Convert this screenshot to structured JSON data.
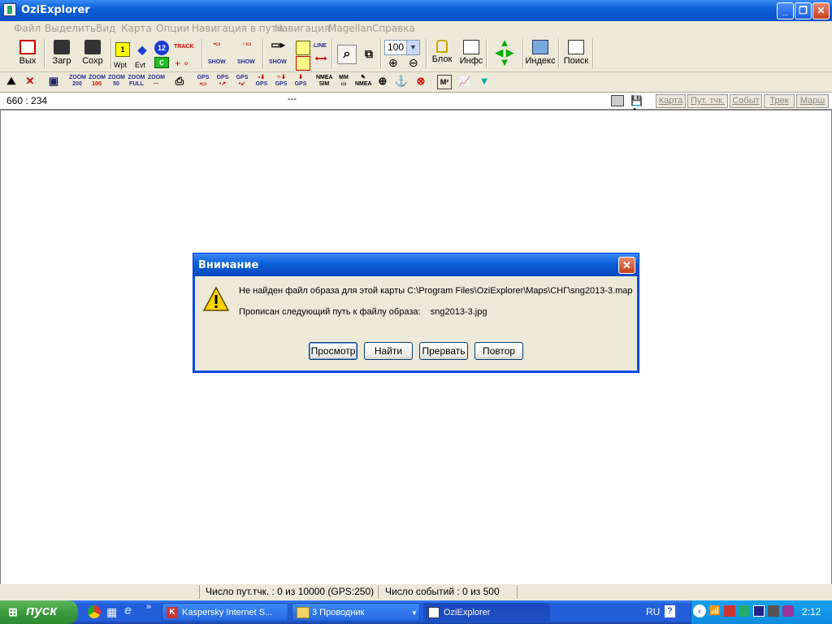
{
  "window": {
    "title": "OziExplorer"
  },
  "menu": [
    "Файл",
    "Выделить",
    "Вид",
    "Карта",
    "Опции",
    "Навигация в пути",
    "Навигация",
    "Magellan",
    "Справка"
  ],
  "toolbar": {
    "exit": "Вых",
    "load": "Загр",
    "save": "Сохр",
    "wpt": "Wpt",
    "evt": "Evt",
    "track": "TRACK",
    "show": "SHOW",
    "line": "LINE",
    "zoom_value": "100",
    "block": "Блок",
    "info": "Инфс",
    "index": "Индекс",
    "search": "Поиск"
  },
  "toolbar2": {
    "zoom200": "200",
    "zoom100": "100",
    "zoom50": "50",
    "zoomfull": "FULL",
    "zoom_word": "ZOOM",
    "gps": "GPS",
    "nmea": "NMEA",
    "sim": "SIM",
    "mm": "MM",
    "m2": "M²"
  },
  "infobar": {
    "coords": "660 : 234",
    "dash": "---",
    "tabs": [
      "Карта",
      "Пут. тчк.",
      "Событ",
      "Трек",
      "Марш"
    ]
  },
  "status": {
    "waypoints": "Число пут.тчк. : 0 из 10000  (GPS:250)",
    "events": "Число событий : 0 из 500"
  },
  "dialog": {
    "title": "Внимание",
    "line1": "Не найден файл образа для этой карты  C:\\Program Files\\OziExplorer\\Maps\\СНГ\\sng2013-3.map",
    "line2": "Прописан следующий путь к файлу образа:    sng2013-3.jpg",
    "buttons": [
      "Просмотр",
      "Найти",
      "Прервать",
      "Повтор"
    ]
  },
  "taskbar": {
    "start": "пуск",
    "tasks": [
      "Kaspersky Internet S...",
      "3 Проводник",
      "OziExplorer"
    ],
    "lang": "RU",
    "clock": "2:12"
  }
}
